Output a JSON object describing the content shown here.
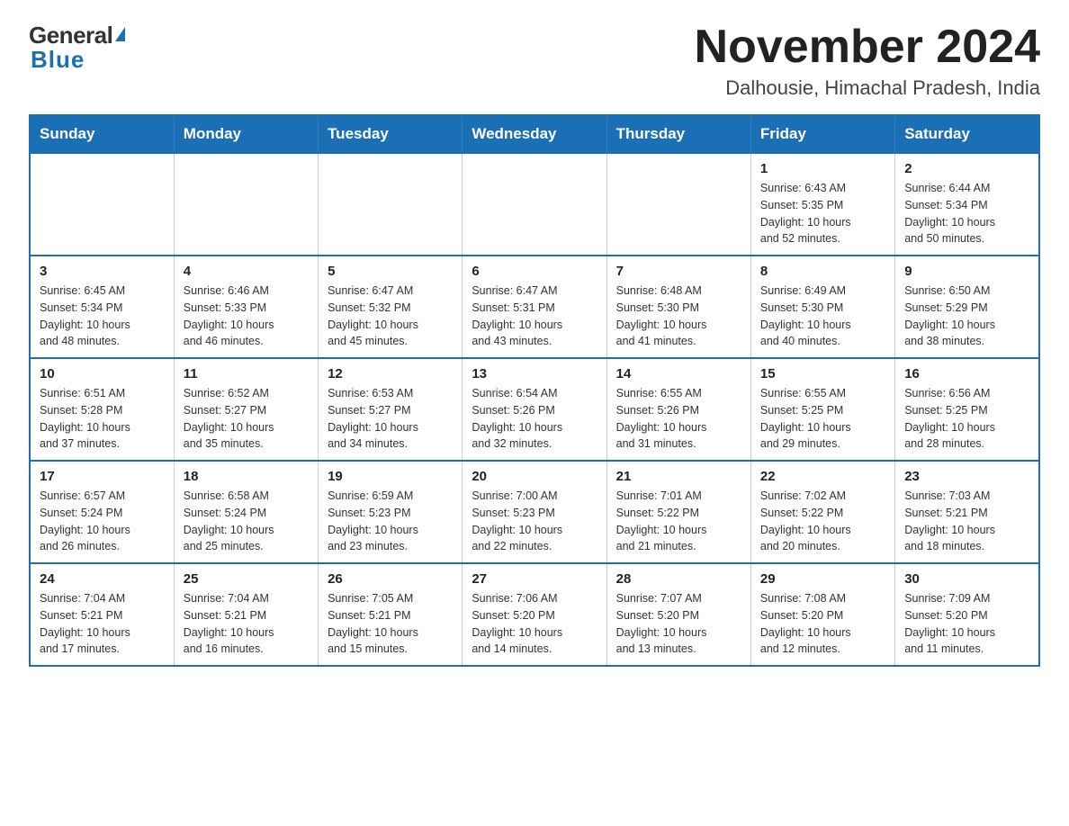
{
  "logo": {
    "text_general": "General",
    "text_blue": "Blue",
    "triangle": "▲"
  },
  "header": {
    "month_year": "November 2024",
    "location": "Dalhousie, Himachal Pradesh, India"
  },
  "days_of_week": [
    "Sunday",
    "Monday",
    "Tuesday",
    "Wednesday",
    "Thursday",
    "Friday",
    "Saturday"
  ],
  "weeks": [
    [
      {
        "day": "",
        "info": ""
      },
      {
        "day": "",
        "info": ""
      },
      {
        "day": "",
        "info": ""
      },
      {
        "day": "",
        "info": ""
      },
      {
        "day": "",
        "info": ""
      },
      {
        "day": "1",
        "info": "Sunrise: 6:43 AM\nSunset: 5:35 PM\nDaylight: 10 hours\nand 52 minutes."
      },
      {
        "day": "2",
        "info": "Sunrise: 6:44 AM\nSunset: 5:34 PM\nDaylight: 10 hours\nand 50 minutes."
      }
    ],
    [
      {
        "day": "3",
        "info": "Sunrise: 6:45 AM\nSunset: 5:34 PM\nDaylight: 10 hours\nand 48 minutes."
      },
      {
        "day": "4",
        "info": "Sunrise: 6:46 AM\nSunset: 5:33 PM\nDaylight: 10 hours\nand 46 minutes."
      },
      {
        "day": "5",
        "info": "Sunrise: 6:47 AM\nSunset: 5:32 PM\nDaylight: 10 hours\nand 45 minutes."
      },
      {
        "day": "6",
        "info": "Sunrise: 6:47 AM\nSunset: 5:31 PM\nDaylight: 10 hours\nand 43 minutes."
      },
      {
        "day": "7",
        "info": "Sunrise: 6:48 AM\nSunset: 5:30 PM\nDaylight: 10 hours\nand 41 minutes."
      },
      {
        "day": "8",
        "info": "Sunrise: 6:49 AM\nSunset: 5:30 PM\nDaylight: 10 hours\nand 40 minutes."
      },
      {
        "day": "9",
        "info": "Sunrise: 6:50 AM\nSunset: 5:29 PM\nDaylight: 10 hours\nand 38 minutes."
      }
    ],
    [
      {
        "day": "10",
        "info": "Sunrise: 6:51 AM\nSunset: 5:28 PM\nDaylight: 10 hours\nand 37 minutes."
      },
      {
        "day": "11",
        "info": "Sunrise: 6:52 AM\nSunset: 5:27 PM\nDaylight: 10 hours\nand 35 minutes."
      },
      {
        "day": "12",
        "info": "Sunrise: 6:53 AM\nSunset: 5:27 PM\nDaylight: 10 hours\nand 34 minutes."
      },
      {
        "day": "13",
        "info": "Sunrise: 6:54 AM\nSunset: 5:26 PM\nDaylight: 10 hours\nand 32 minutes."
      },
      {
        "day": "14",
        "info": "Sunrise: 6:55 AM\nSunset: 5:26 PM\nDaylight: 10 hours\nand 31 minutes."
      },
      {
        "day": "15",
        "info": "Sunrise: 6:55 AM\nSunset: 5:25 PM\nDaylight: 10 hours\nand 29 minutes."
      },
      {
        "day": "16",
        "info": "Sunrise: 6:56 AM\nSunset: 5:25 PM\nDaylight: 10 hours\nand 28 minutes."
      }
    ],
    [
      {
        "day": "17",
        "info": "Sunrise: 6:57 AM\nSunset: 5:24 PM\nDaylight: 10 hours\nand 26 minutes."
      },
      {
        "day": "18",
        "info": "Sunrise: 6:58 AM\nSunset: 5:24 PM\nDaylight: 10 hours\nand 25 minutes."
      },
      {
        "day": "19",
        "info": "Sunrise: 6:59 AM\nSunset: 5:23 PM\nDaylight: 10 hours\nand 23 minutes."
      },
      {
        "day": "20",
        "info": "Sunrise: 7:00 AM\nSunset: 5:23 PM\nDaylight: 10 hours\nand 22 minutes."
      },
      {
        "day": "21",
        "info": "Sunrise: 7:01 AM\nSunset: 5:22 PM\nDaylight: 10 hours\nand 21 minutes."
      },
      {
        "day": "22",
        "info": "Sunrise: 7:02 AM\nSunset: 5:22 PM\nDaylight: 10 hours\nand 20 minutes."
      },
      {
        "day": "23",
        "info": "Sunrise: 7:03 AM\nSunset: 5:21 PM\nDaylight: 10 hours\nand 18 minutes."
      }
    ],
    [
      {
        "day": "24",
        "info": "Sunrise: 7:04 AM\nSunset: 5:21 PM\nDaylight: 10 hours\nand 17 minutes."
      },
      {
        "day": "25",
        "info": "Sunrise: 7:04 AM\nSunset: 5:21 PM\nDaylight: 10 hours\nand 16 minutes."
      },
      {
        "day": "26",
        "info": "Sunrise: 7:05 AM\nSunset: 5:21 PM\nDaylight: 10 hours\nand 15 minutes."
      },
      {
        "day": "27",
        "info": "Sunrise: 7:06 AM\nSunset: 5:20 PM\nDaylight: 10 hours\nand 14 minutes."
      },
      {
        "day": "28",
        "info": "Sunrise: 7:07 AM\nSunset: 5:20 PM\nDaylight: 10 hours\nand 13 minutes."
      },
      {
        "day": "29",
        "info": "Sunrise: 7:08 AM\nSunset: 5:20 PM\nDaylight: 10 hours\nand 12 minutes."
      },
      {
        "day": "30",
        "info": "Sunrise: 7:09 AM\nSunset: 5:20 PM\nDaylight: 10 hours\nand 11 minutes."
      }
    ]
  ]
}
